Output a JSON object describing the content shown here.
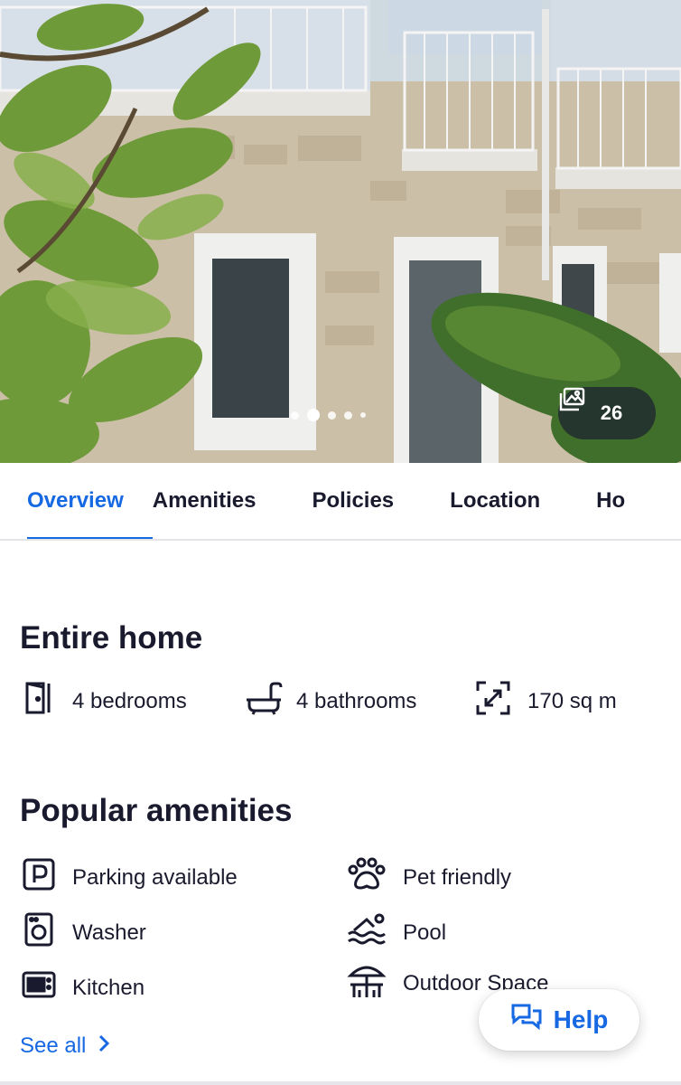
{
  "hero": {
    "gallery_count": "26",
    "carousel_dots": 5,
    "active_dot": 1
  },
  "tabs": [
    {
      "label": "Overview",
      "active": true
    },
    {
      "label": "Amenities",
      "active": false
    },
    {
      "label": "Policies",
      "active": false
    },
    {
      "label": "Location",
      "active": false
    },
    {
      "label": "Ho",
      "active": false
    }
  ],
  "property": {
    "title": "Entire home",
    "specs": [
      {
        "icon": "door-icon",
        "label": "4 bedrooms"
      },
      {
        "icon": "bathtub-icon",
        "label": "4 bathrooms"
      },
      {
        "icon": "expand-icon",
        "label": "170 sq m"
      }
    ]
  },
  "amenities": {
    "title": "Popular amenities",
    "items": [
      {
        "icon": "parking-icon",
        "label": "Parking available"
      },
      {
        "icon": "paw-icon",
        "label": "Pet friendly"
      },
      {
        "icon": "washer-icon",
        "label": "Washer"
      },
      {
        "icon": "pool-icon",
        "label": "Pool"
      },
      {
        "icon": "kitchen-icon",
        "label": "Kitchen"
      },
      {
        "icon": "outdoor-icon",
        "label": "Outdoor Space"
      }
    ],
    "see_all": "See all"
  },
  "help": {
    "label": "Help"
  },
  "colors": {
    "accent": "#1668e3",
    "text": "#1a1a2e",
    "divider": "#e3e4e8"
  }
}
